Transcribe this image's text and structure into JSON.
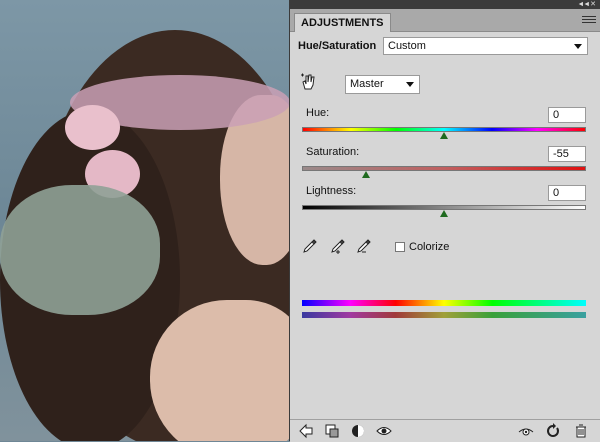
{
  "panel": {
    "tab_label": "ADJUSTMENTS",
    "adjustment_title": "Hue/Saturation",
    "preset_value": "Custom",
    "channel_value": "Master",
    "hue": {
      "label": "Hue:",
      "value": "0",
      "fraction": 0.5
    },
    "saturation": {
      "label": "Saturation:",
      "value": "-55",
      "fraction": 0.225
    },
    "lightness": {
      "label": "Lightness:",
      "value": "0",
      "fraction": 0.5
    },
    "colorize_label": "Colorize",
    "colorize_checked": false
  },
  "icons": {
    "collapse": "collapse-arrows-icon",
    "menu": "panel-menu-icon",
    "hand": "targeted-adjustment-hand-icon",
    "droppers": [
      "eyedropper-icon",
      "eyedropper-plus-icon",
      "eyedropper-minus-icon"
    ],
    "footer": [
      "back-arrow-icon",
      "clip-to-layer-icon",
      "mask-icon",
      "visibility-eye-icon",
      "view-previous-icon",
      "reset-icon",
      "trash-icon"
    ]
  },
  "colors": {
    "panel_bg": "#d6d6d6",
    "thumb": "#1f6a1f"
  }
}
